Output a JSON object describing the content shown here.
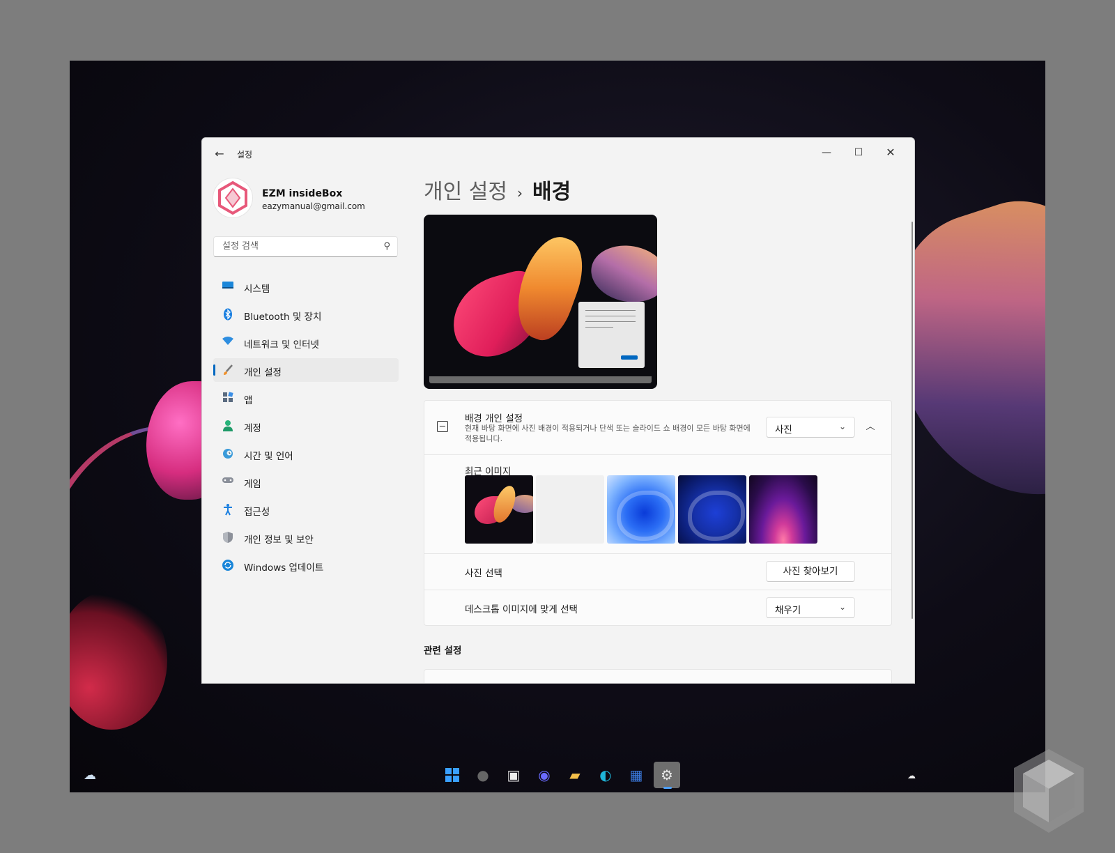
{
  "window": {
    "app_title": "설정",
    "controls": {
      "minimize": "—",
      "maximize": "☐",
      "close": "✕"
    }
  },
  "profile": {
    "name": "EZM insideBox",
    "email": "eazymanual@gmail.com"
  },
  "search": {
    "placeholder": "설정 검색"
  },
  "nav": {
    "items": [
      {
        "label": "시스템",
        "icon": "monitor-icon"
      },
      {
        "label": "Bluetooth 및 장치",
        "icon": "bluetooth-icon"
      },
      {
        "label": "네트워크 및 인터넷",
        "icon": "wifi-icon"
      },
      {
        "label": "개인 설정",
        "icon": "brush-icon",
        "active": true
      },
      {
        "label": "앱",
        "icon": "apps-icon"
      },
      {
        "label": "계정",
        "icon": "person-icon"
      },
      {
        "label": "시간 및 언어",
        "icon": "globe-clock-icon"
      },
      {
        "label": "게임",
        "icon": "gamepad-icon"
      },
      {
        "label": "접근성",
        "icon": "accessibility-icon"
      },
      {
        "label": "개인 정보 및 보안",
        "icon": "shield-icon"
      },
      {
        "label": "Windows 업데이트",
        "icon": "update-icon"
      }
    ]
  },
  "breadcrumb": {
    "parent": "개인 설정",
    "separator": "›",
    "current": "배경"
  },
  "background_card": {
    "title": "배경 개인 설정",
    "description": "현재 바탕 화면에 사진 배경이 적용되거나 단색 또는 슬라이드 쇼 배경이 모든 바탕 화면에 적용됩니다.",
    "dropdown_value": "사진"
  },
  "recent_images": {
    "label": "최근 이미지"
  },
  "photo_select": {
    "label": "사진 선택",
    "button": "사진 찾아보기"
  },
  "fit_select": {
    "label": "데스크톱 이미지에 맞게 선택",
    "dropdown_value": "채우기"
  },
  "related": {
    "title": "관련 설정"
  },
  "colors": {
    "accent": "#0067c0"
  }
}
